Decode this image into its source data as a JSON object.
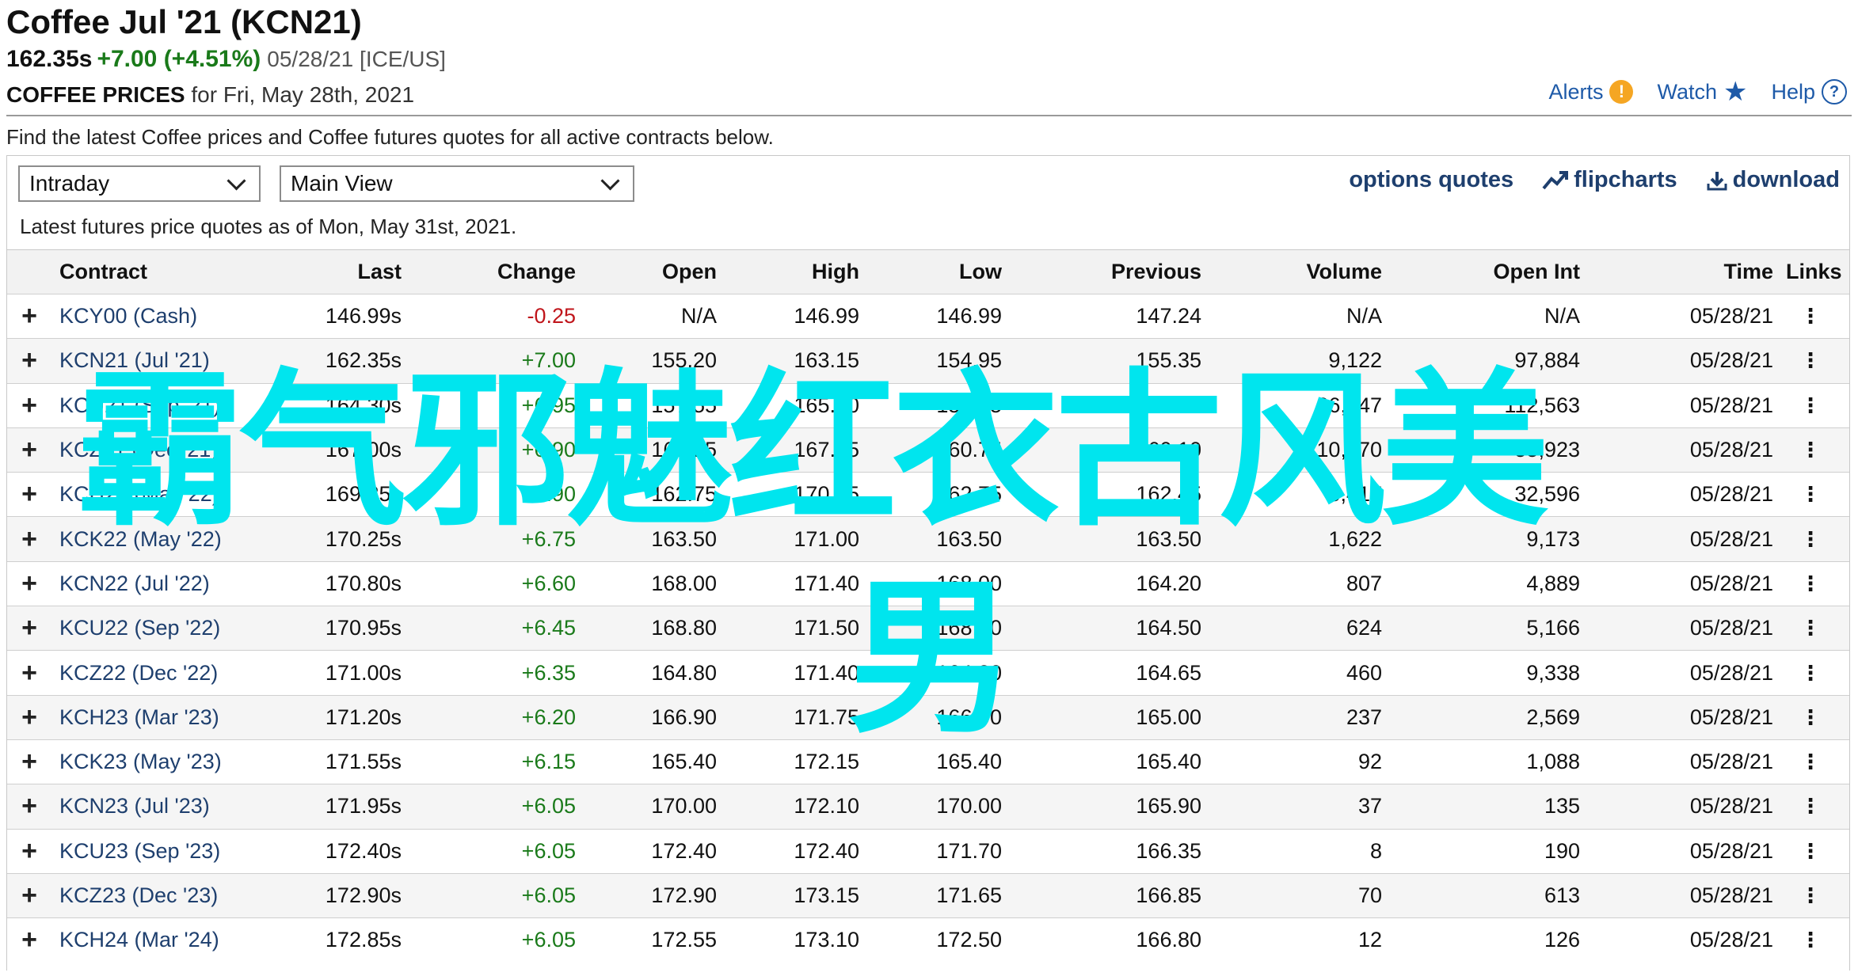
{
  "header": {
    "title": "Coffee Jul '21 (KCN21)",
    "price": "162.35s",
    "change": "+7.00 (+4.51%)",
    "date_exchange": "05/28/21 [ICE/US]",
    "prices_label": "COFFEE PRICES",
    "prices_date": "for Fri, May 28th, 2021"
  },
  "toplinks": {
    "alerts": "Alerts",
    "watch": "Watch",
    "help": "Help"
  },
  "description": "Find the latest Coffee prices and Coffee futures quotes for all active contracts below.",
  "controls": {
    "period_select": "Intraday",
    "view_select": "Main View",
    "options_quotes": "options quotes",
    "flipcharts": "flipcharts",
    "download": "download",
    "as_of": "Latest futures price quotes as of Mon, May 31st, 2021."
  },
  "table": {
    "columns": [
      "Contract",
      "Last",
      "Change",
      "Open",
      "High",
      "Low",
      "Previous",
      "Volume",
      "Open Int",
      "Time",
      "Links"
    ],
    "rows": [
      {
        "contract": "KCY00 (Cash)",
        "last": "146.99s",
        "change": "-0.25",
        "dir": "neg",
        "open": "N/A",
        "high": "146.99",
        "low": "146.99",
        "previous": "147.24",
        "volume": "N/A",
        "open_int": "N/A",
        "time": "05/28/21"
      },
      {
        "contract": "KCN21 (Jul '21)",
        "last": "162.35s",
        "change": "+7.00",
        "dir": "pos",
        "open": "155.20",
        "high": "163.15",
        "low": "154.95",
        "previous": "155.35",
        "volume": "9,122",
        "open_int": "97,884",
        "time": "05/28/21"
      },
      {
        "contract": "KCU21 (Sep '21)",
        "last": "164.30s",
        "change": "+6.95",
        "dir": "pos",
        "open": "157.55",
        "high": "165.10",
        "low": "157.15",
        "previous": "157.35",
        "volume": "26,447",
        "open_int": "112,563",
        "time": "05/28/21"
      },
      {
        "contract": "KCZ21 (Dec '21)",
        "last": "167.00s",
        "change": "+6.90",
        "dir": "pos",
        "open": "160.25",
        "high": "167.85",
        "low": "160.75",
        "previous": "160.10",
        "volume": "10,070",
        "open_int": "55,923",
        "time": "05/28/21"
      },
      {
        "contract": "KCH22 (Mar '22)",
        "last": "169.35s",
        "change": "+6.90",
        "dir": "pos",
        "open": "162.75",
        "high": "170.15",
        "low": "162.75",
        "previous": "162.45",
        "volume": "6,417",
        "open_int": "32,596",
        "time": "05/28/21"
      },
      {
        "contract": "KCK22 (May '22)",
        "last": "170.25s",
        "change": "+6.75",
        "dir": "pos",
        "open": "163.50",
        "high": "171.00",
        "low": "163.50",
        "previous": "163.50",
        "volume": "1,622",
        "open_int": "9,173",
        "time": "05/28/21"
      },
      {
        "contract": "KCN22 (Jul '22)",
        "last": "170.80s",
        "change": "+6.60",
        "dir": "pos",
        "open": "168.00",
        "high": "171.40",
        "low": "168.00",
        "previous": "164.20",
        "volume": "807",
        "open_int": "4,889",
        "time": "05/28/21"
      },
      {
        "contract": "KCU22 (Sep '22)",
        "last": "170.95s",
        "change": "+6.45",
        "dir": "pos",
        "open": "168.80",
        "high": "171.50",
        "low": "168.80",
        "previous": "164.50",
        "volume": "624",
        "open_int": "5,166",
        "time": "05/28/21"
      },
      {
        "contract": "KCZ22 (Dec '22)",
        "last": "171.00s",
        "change": "+6.35",
        "dir": "pos",
        "open": "164.80",
        "high": "171.40",
        "low": "164.80",
        "previous": "164.65",
        "volume": "460",
        "open_int": "9,338",
        "time": "05/28/21"
      },
      {
        "contract": "KCH23 (Mar '23)",
        "last": "171.20s",
        "change": "+6.20",
        "dir": "pos",
        "open": "166.90",
        "high": "171.75",
        "low": "166.90",
        "previous": "165.00",
        "volume": "237",
        "open_int": "2,569",
        "time": "05/28/21"
      },
      {
        "contract": "KCK23 (May '23)",
        "last": "171.55s",
        "change": "+6.15",
        "dir": "pos",
        "open": "165.40",
        "high": "172.15",
        "low": "165.40",
        "previous": "165.40",
        "volume": "92",
        "open_int": "1,088",
        "time": "05/28/21"
      },
      {
        "contract": "KCN23 (Jul '23)",
        "last": "171.95s",
        "change": "+6.05",
        "dir": "pos",
        "open": "170.00",
        "high": "172.10",
        "low": "170.00",
        "previous": "165.90",
        "volume": "37",
        "open_int": "135",
        "time": "05/28/21"
      },
      {
        "contract": "KCU23 (Sep '23)",
        "last": "172.40s",
        "change": "+6.05",
        "dir": "pos",
        "open": "172.40",
        "high": "172.40",
        "low": "171.70",
        "previous": "166.35",
        "volume": "8",
        "open_int": "190",
        "time": "05/28/21"
      },
      {
        "contract": "KCZ23 (Dec '23)",
        "last": "172.90s",
        "change": "+6.05",
        "dir": "pos",
        "open": "172.90",
        "high": "173.15",
        "low": "171.65",
        "previous": "166.85",
        "volume": "70",
        "open_int": "613",
        "time": "05/28/21"
      },
      {
        "contract": "KCH24 (Mar '24)",
        "last": "172.85s",
        "change": "+6.05",
        "dir": "pos",
        "open": "172.55",
        "high": "173.10",
        "low": "172.50",
        "previous": "166.80",
        "volume": "12",
        "open_int": "126",
        "time": "05/28/21"
      }
    ]
  },
  "watermark": {
    "line1": "霸气邪魅红衣古风美",
    "line2": "男"
  },
  "colors": {
    "accent": "#1e3f6e",
    "positive": "#1a7a1a",
    "negative": "#c0151b",
    "watermark": "#00e5ee"
  }
}
